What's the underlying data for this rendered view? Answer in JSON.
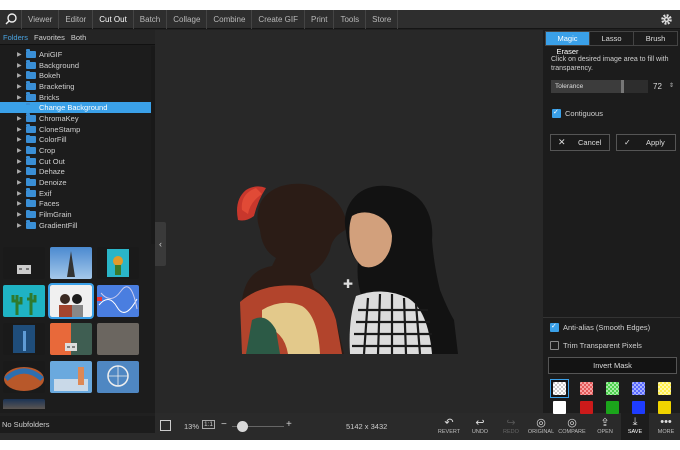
{
  "menu": {
    "items": [
      "Viewer",
      "Editor",
      "Cut Out",
      "Batch",
      "Collage",
      "Combine",
      "Create GIF",
      "Print",
      "Tools",
      "Store"
    ],
    "active": "Cut Out"
  },
  "left": {
    "tabs": [
      "Folders",
      "Favorites",
      "Both"
    ],
    "folders": [
      "AniGIF",
      "Background",
      "Bokeh",
      "Bracketing",
      "Bricks",
      "Change Background",
      "ChromaKey",
      "CloneStamp",
      "ColorFill",
      "Crop",
      "Cut Out",
      "Dehaze",
      "Denoize",
      "Exif",
      "Faces",
      "FilmGrain",
      "GradientFill"
    ],
    "selected_folder": "Change Background",
    "no_subfolders": "No Subfolders"
  },
  "canvas": {
    "zoom": "13%",
    "fit_label": "1:1",
    "zoom_minus": "−",
    "zoom_plus": "+",
    "zoom_fraction": 0.2,
    "dimensions": "5142 x 3432"
  },
  "bottom_actions": {
    "revert": "REVERT",
    "undo": "UNDO",
    "redo": "REDO",
    "original": "ORIGINAL",
    "compare": "COMPARE",
    "open": "OPEN",
    "save": "SAVE",
    "more": "MORE"
  },
  "right": {
    "tabs": [
      "Magic Eraser",
      "Lasso",
      "Brush"
    ],
    "active_tab": "Magic Eraser",
    "hint": "Click on desired image area to fill with transparency.",
    "tolerance_label": "Tolerance",
    "tolerance_value": "72",
    "tolerance_fraction": 0.72,
    "contiguous_label": "Contiguous",
    "contiguous_checked": true,
    "cancel_label": "Cancel",
    "apply_label": "Apply",
    "antialias_label": "Anti-alias (Smooth Edges)",
    "antialias_checked": true,
    "trim_label": "Trim Transparent Pixels",
    "trim_checked": false,
    "invert_label": "Invert Mask",
    "colors": {
      "accent": "#3aa0e8",
      "swatches_row1": [
        "checker",
        "#e45b5b",
        "#4cd04c",
        "checker-blue",
        "#ffef4a"
      ],
      "swatches_row2": [
        "#ffffff",
        "#cc1a1a",
        "#1ba51b",
        "#1e3cff",
        "#f0d400"
      ]
    }
  }
}
